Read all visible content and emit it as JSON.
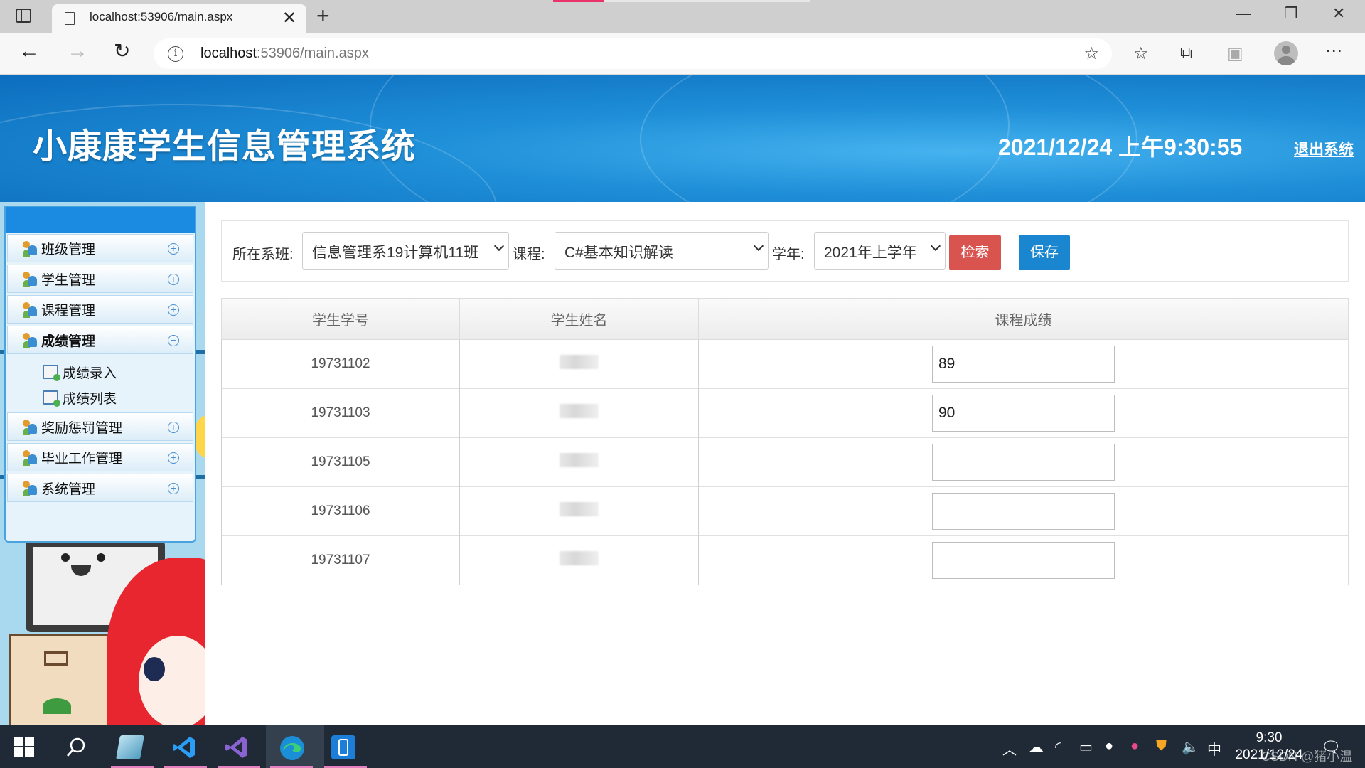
{
  "browser": {
    "tab_title": "localhost:53906/main.aspx",
    "url_host": "localhost",
    "url_path": ":53906/main.aspx"
  },
  "header": {
    "title": "小康康学生信息管理系统",
    "datetime": "2021/12/24 上午9:30:55",
    "logout": "退出系统"
  },
  "sidebar": {
    "items": [
      {
        "label": "班级管理"
      },
      {
        "label": "学生管理"
      },
      {
        "label": "课程管理"
      },
      {
        "label": "成绩管理"
      },
      {
        "label": "奖励惩罚管理"
      },
      {
        "label": "毕业工作管理"
      },
      {
        "label": "系统管理"
      }
    ],
    "sub_items": [
      {
        "label": "成绩录入"
      },
      {
        "label": "成绩列表"
      }
    ]
  },
  "filter": {
    "class_label": "所在系班:",
    "class_value": "信息管理系19计算机11班",
    "course_label": "课程:",
    "course_value": "C#基本知识解读",
    "year_label": "学年:",
    "year_value": "2021年上学年",
    "search_button": "检索",
    "save_button": "保存"
  },
  "table": {
    "headers": [
      "学生学号",
      "学生姓名",
      "课程成绩"
    ],
    "rows": [
      {
        "id": "19731102",
        "score": "89"
      },
      {
        "id": "19731103",
        "score": "90"
      },
      {
        "id": "19731105",
        "score": ""
      },
      {
        "id": "19731106",
        "score": ""
      },
      {
        "id": "19731107",
        "score": ""
      }
    ]
  },
  "taskbar": {
    "ime": "中",
    "time": "9:30",
    "date": "2021/12/24",
    "watermark": "CSDN @猪小温"
  },
  "colors": {
    "header_blue": "#1f8fd8",
    "search_red": "#d9534f",
    "save_blue": "#1a86d0",
    "menu_border": "#4aa3df"
  }
}
